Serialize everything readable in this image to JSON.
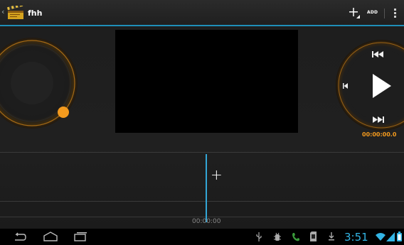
{
  "action_bar": {
    "title": "fhh",
    "add_label": "ADD"
  },
  "transport": {
    "time": "00:00:00.0"
  },
  "timeline": {
    "timecode": "00:00:00",
    "add_clip_symbol": "+"
  },
  "status_bar": {
    "clock": "3:51"
  },
  "colors": {
    "accent_blue": "#33b5e5",
    "accent_orange": "#f39a1e"
  },
  "icons": [
    "back-icon",
    "home-icon",
    "recent-apps-icon",
    "usb-icon",
    "debug-icon",
    "phone-icon",
    "sdcard-icon",
    "download-icon",
    "wifi-icon",
    "signal-icon",
    "battery-icon"
  ]
}
